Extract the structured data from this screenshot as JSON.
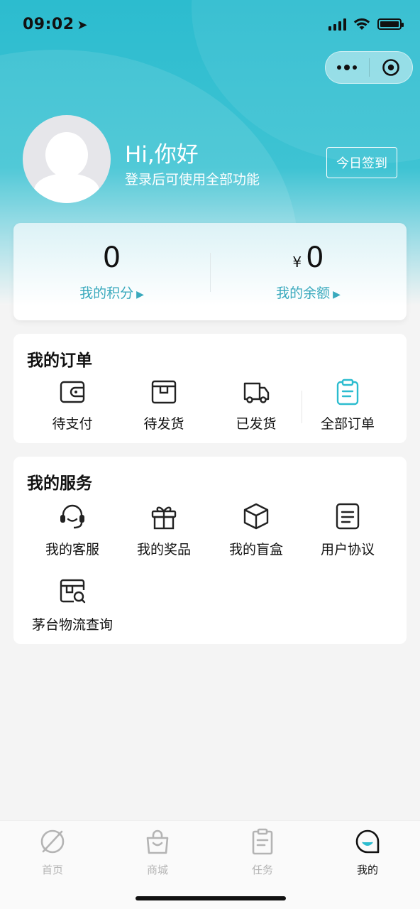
{
  "status_bar": {
    "time": "09:02",
    "arrow": "➤"
  },
  "profile": {
    "greeting": "Hi,你好",
    "subtitle": "登录后可使用全部功能",
    "checkin_label": "今日签到"
  },
  "stats": {
    "points_value": "0",
    "points_label": "我的积分",
    "balance_currency": "¥",
    "balance_value": "0",
    "balance_label": "我的余额",
    "arrow": "▶"
  },
  "orders": {
    "title": "我的订单",
    "items": [
      {
        "label": "待支付",
        "icon": "wallet-icon"
      },
      {
        "label": "待发货",
        "icon": "package-box-icon"
      },
      {
        "label": "已发货",
        "icon": "delivery-truck-icon"
      },
      {
        "label": "全部订单",
        "icon": "clipboard-icon"
      }
    ]
  },
  "services": {
    "title": "我的服务",
    "items": [
      {
        "label": "我的客服",
        "icon": "headset-icon"
      },
      {
        "label": "我的奖品",
        "icon": "gift-icon"
      },
      {
        "label": "我的盲盒",
        "icon": "cube-box-icon"
      },
      {
        "label": "用户协议",
        "icon": "document-icon"
      },
      {
        "label": "茅台物流查询",
        "icon": "logistics-search-icon"
      }
    ]
  },
  "tabbar": {
    "items": [
      {
        "label": "首页",
        "icon": "compass-icon"
      },
      {
        "label": "商城",
        "icon": "shopping-bag-icon"
      },
      {
        "label": "任务",
        "icon": "task-list-icon"
      },
      {
        "label": "我的",
        "icon": "user-profile-icon"
      }
    ],
    "active_index": 3
  },
  "colors": {
    "accent": "#2cbccf",
    "link": "#39a9bd",
    "inactive": "#b4b4b4"
  }
}
